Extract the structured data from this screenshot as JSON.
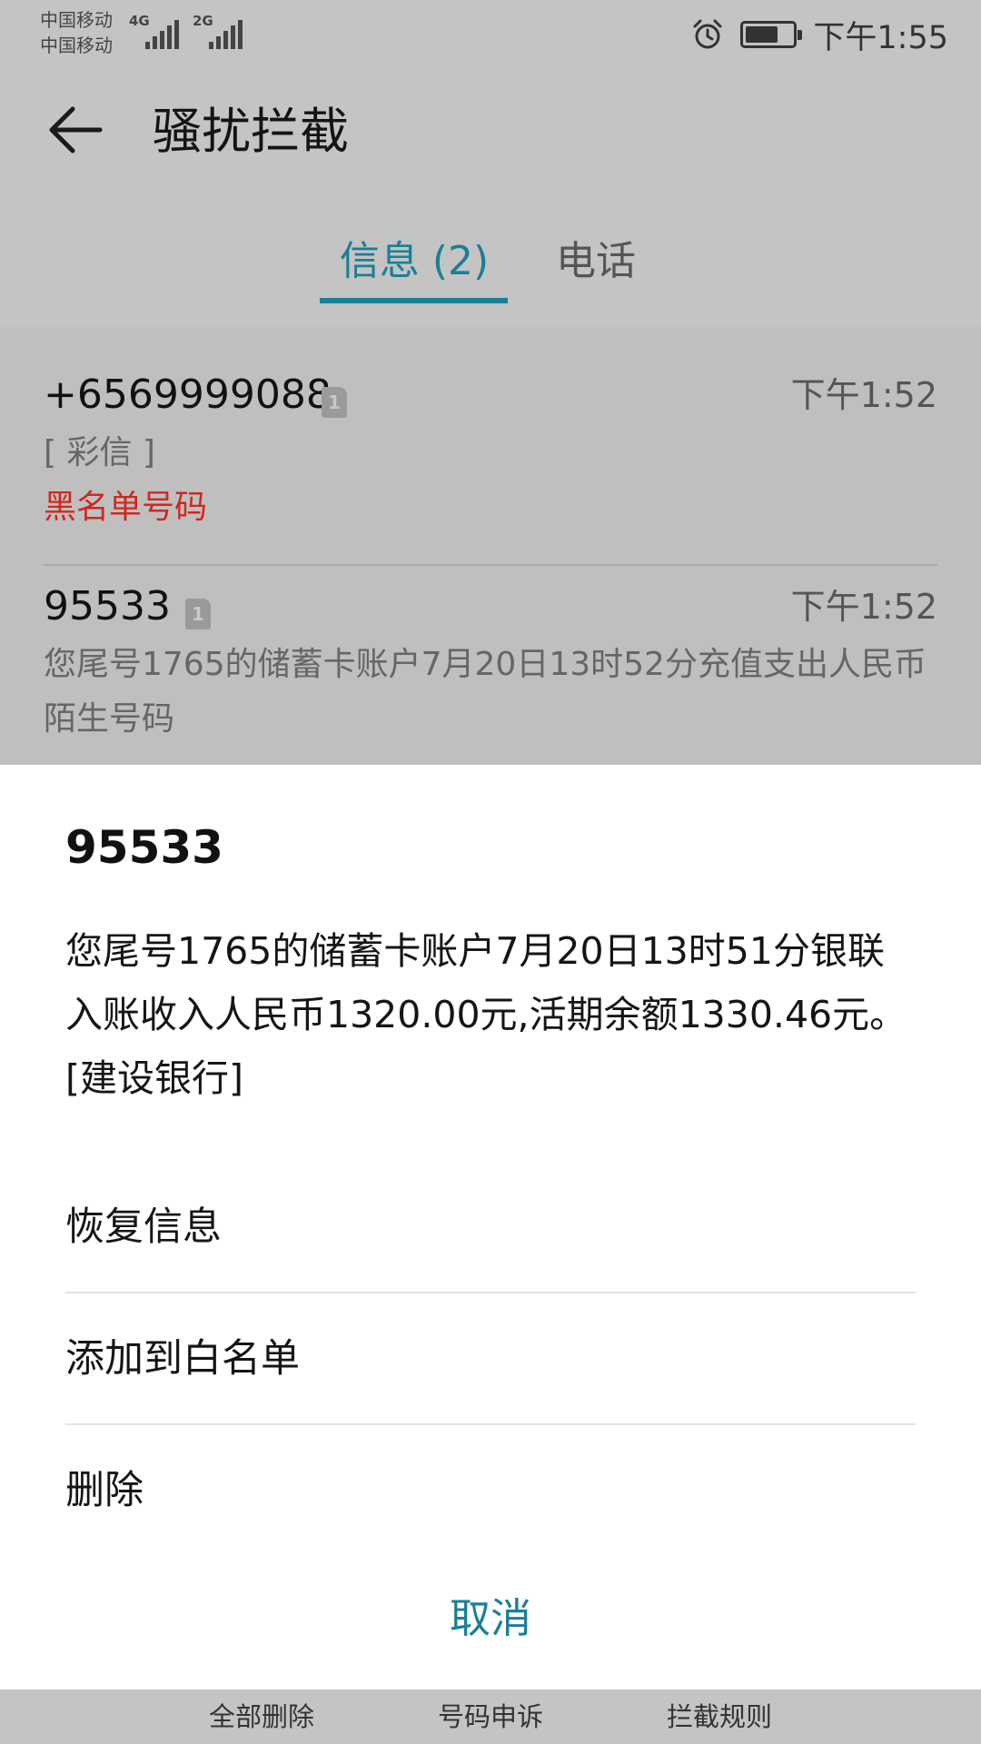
{
  "status_bar": {
    "carrier_1": "中国移动",
    "carrier_2": "中国移动",
    "network_1": "4G",
    "network_2": "2G",
    "time": "下午1:55",
    "battery_level": 0.7,
    "icons": [
      "alarm-icon",
      "battery-icon"
    ]
  },
  "header": {
    "title": "骚扰拦截",
    "back_icon": "back-arrow-icon"
  },
  "tabs": [
    {
      "label": "信息 (2)",
      "active": true
    },
    {
      "label": "电话",
      "active": false
    }
  ],
  "messages": [
    {
      "sender": "+6569999088",
      "sim": "1",
      "time": "下午1:52",
      "preview": "[ 彩信 ]",
      "tag": "黑名单号码",
      "tag_color": "#d0281f"
    },
    {
      "sender": "95533",
      "sim": "1",
      "time": "下午1:52",
      "preview": "您尾号1765的储蓄卡账户7月20日13时52分充值支出人民币",
      "tag": "陌生号码",
      "tag_color": "#666666"
    }
  ],
  "sheet": {
    "title": "95533",
    "body": "您尾号1765的储蓄卡账户7月20日13时51分银联入账收入人民币1320.00元,活期余额1330.46元。[建设银行]",
    "actions": [
      "恢复信息",
      "添加到白名单",
      "删除"
    ],
    "cancel": "取消"
  },
  "toolbar": {
    "items": [
      "全部删除",
      "号码申诉",
      "拦截规则"
    ]
  },
  "colors": {
    "accent": "#1a7f98",
    "blacklist_red": "#d0281f",
    "overlay_bg": "#c4c4c4",
    "sheet_bg": "#ffffff"
  }
}
